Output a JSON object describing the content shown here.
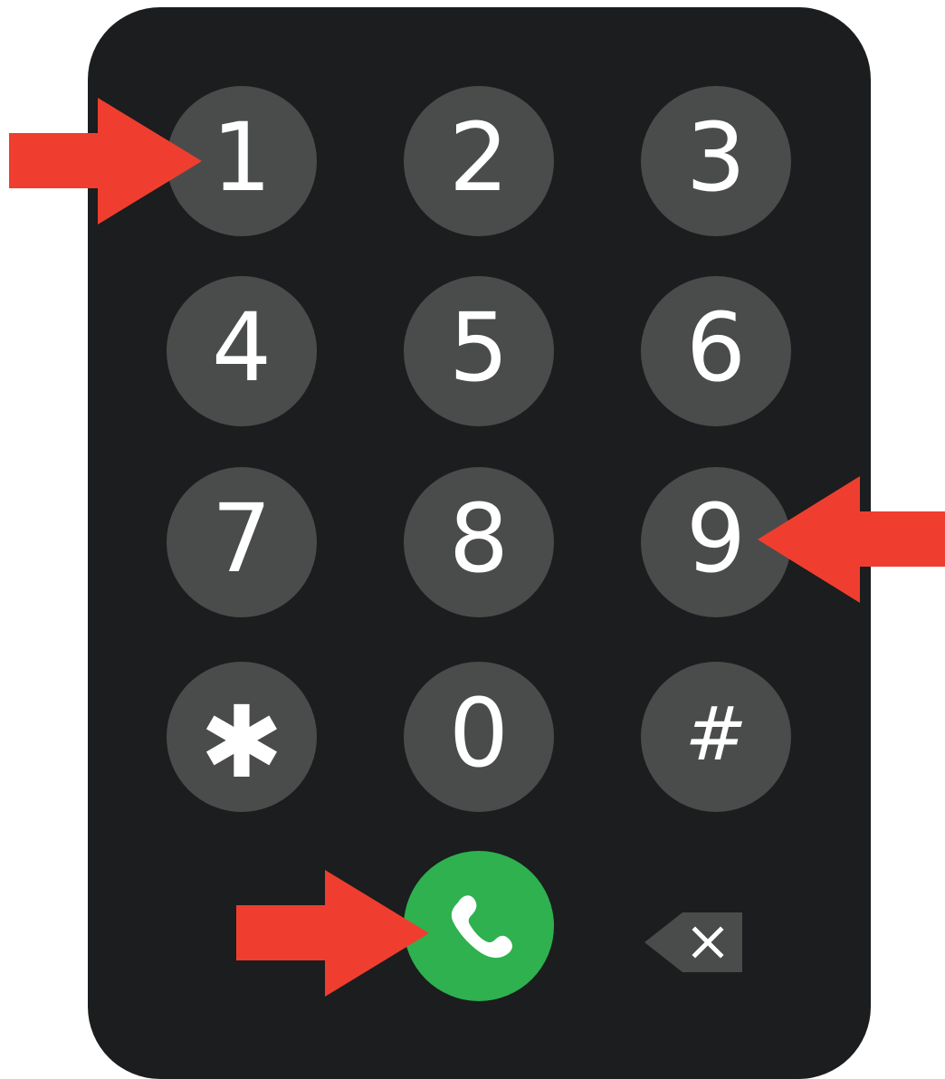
{
  "keypad": {
    "keys": [
      {
        "label": "1",
        "name": "key-1"
      },
      {
        "label": "2",
        "name": "key-2"
      },
      {
        "label": "3",
        "name": "key-3"
      },
      {
        "label": "4",
        "name": "key-4"
      },
      {
        "label": "5",
        "name": "key-5"
      },
      {
        "label": "6",
        "name": "key-6"
      },
      {
        "label": "7",
        "name": "key-7"
      },
      {
        "label": "8",
        "name": "key-8"
      },
      {
        "label": "9",
        "name": "key-9"
      },
      {
        "label": "✱",
        "name": "key-star"
      },
      {
        "label": "0",
        "name": "key-0"
      },
      {
        "label": "#",
        "name": "key-hash"
      }
    ],
    "call_icon": "phone-icon",
    "backspace_icon": "backspace-icon"
  },
  "colors": {
    "panel": "#1b1d1e",
    "key": "#4a4c4b",
    "call": "#2eb14e",
    "arrow": "#ef3e2f",
    "text": "#ffffff"
  },
  "annotations": {
    "arrows": [
      {
        "target": "key-1",
        "icon": "red-arrow-right-icon"
      },
      {
        "target": "key-9",
        "icon": "red-arrow-left-icon"
      },
      {
        "target": "call-button",
        "icon": "red-arrow-right-icon"
      }
    ]
  }
}
